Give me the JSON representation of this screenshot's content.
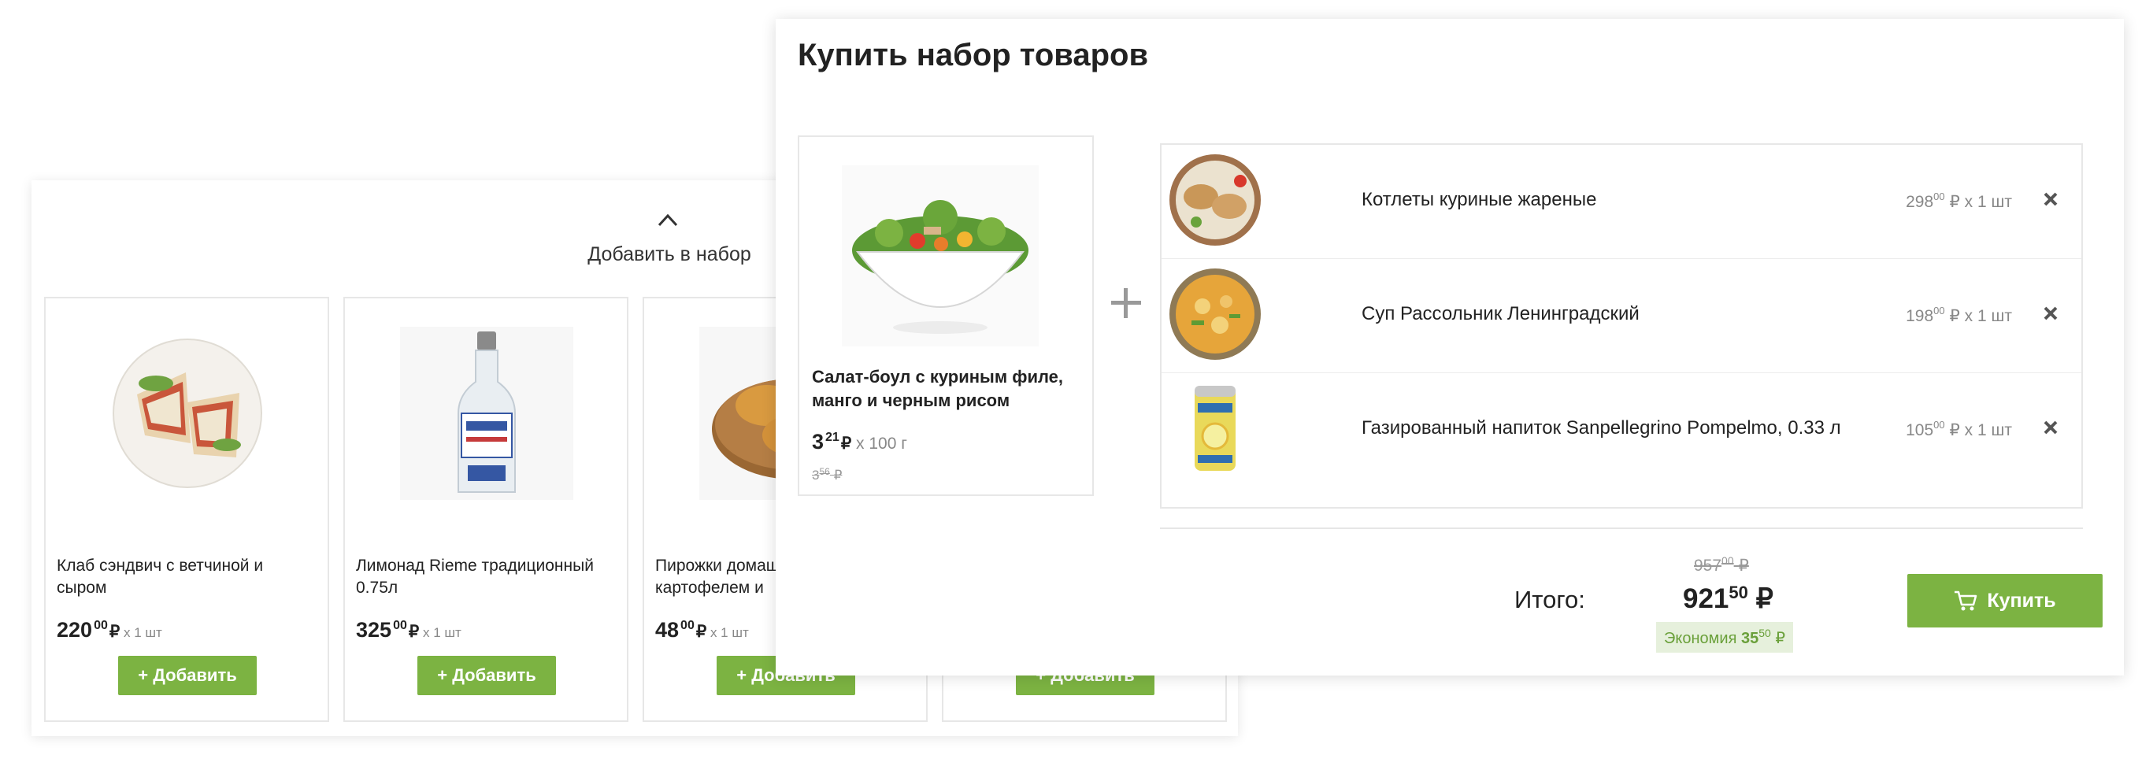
{
  "carousel": {
    "add_to_set_label": "Добавить в набор",
    "cards": [
      {
        "name": "Клаб сэндвич с ветчиной и сыром",
        "price_int": "220",
        "price_dec": "00",
        "currency": "₽",
        "qty": "x 1 шт",
        "button_label": "+ Добавить"
      },
      {
        "name": "Лимонад Rieme традиционный 0.75л",
        "price_int": "325",
        "price_dec": "00",
        "currency": "₽",
        "qty": "x 1 шт",
        "button_label": "+ Добавить"
      },
      {
        "name": "Пирожки домашние с картофелем и",
        "price_int": "48",
        "price_dec": "00",
        "currency": "₽",
        "qty": "x 1 шт",
        "button_label": "+ Добавить"
      },
      {
        "name": "",
        "price_int": "",
        "price_dec": "",
        "currency": "",
        "qty": "",
        "button_label": "+ Добавить"
      }
    ]
  },
  "modal": {
    "title": "Купить набор товаров",
    "main_product": {
      "name": "Салат-боул с куриным филе, манго и черным рисом",
      "price_int": "3",
      "price_dec": "21",
      "currency": "₽",
      "qty": "x 100 г",
      "old_price_int": "3",
      "old_price_dec": "56",
      "old_currency": "₽"
    },
    "items": [
      {
        "name": "Котлеты куриные жареные",
        "price_int": "298",
        "price_dec": "00",
        "suffix": "₽ x 1 шт"
      },
      {
        "name": "Суп Рассольник Ленинградский",
        "price_int": "198",
        "price_dec": "00",
        "suffix": "₽ x 1 шт"
      },
      {
        "name": "Газированный напиток Sanpellegrino Pompelmo, 0.33 л",
        "price_int": "105",
        "price_dec": "00",
        "suffix": "₽ x 1 шт"
      }
    ],
    "total": {
      "label": "Итого:",
      "old_int": "957",
      "old_dec": "00",
      "old_currency": "₽",
      "new_int": "921",
      "new_dec": "50",
      "new_currency": "₽",
      "economy_label": "Экономия",
      "economy_int": "35",
      "economy_dec": "50",
      "economy_currency": "₽"
    },
    "buy_label": "Купить"
  },
  "colors": {
    "accent": "#7cb342",
    "economy_bg": "#e6f0dc",
    "economy_text": "#6aa03a"
  },
  "icons": [
    "chevron-up-icon",
    "chevron-left-icon",
    "plus-icon",
    "close-icon",
    "cart-icon"
  ]
}
